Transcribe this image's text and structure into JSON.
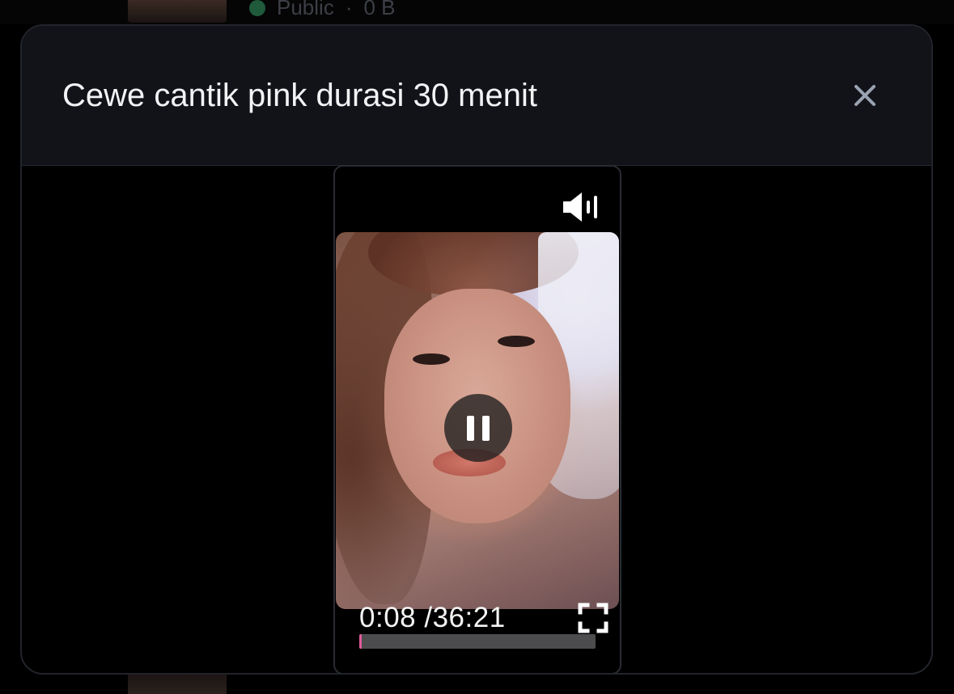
{
  "background": {
    "visibility_label": "Public",
    "size_label": "0 B"
  },
  "modal": {
    "title": "Cewe cantik pink durasi 30 menit",
    "close_icon": "close-icon"
  },
  "player": {
    "current_time": "0:08",
    "time_separator": "/",
    "duration": "36:21",
    "progress_fraction": 0.0037,
    "state": "playing",
    "icons": {
      "volume": "volume-icon",
      "pause": "pause-icon",
      "fullscreen": "fullscreen-icon"
    }
  },
  "colors": {
    "header_bg": "#121319",
    "modal_bg": "#000000",
    "progress_fill": "#e05a9a",
    "progress_track": "#4c4c4e",
    "title_text": "#f2f3f5",
    "close_icon": "#9aa3b2"
  }
}
